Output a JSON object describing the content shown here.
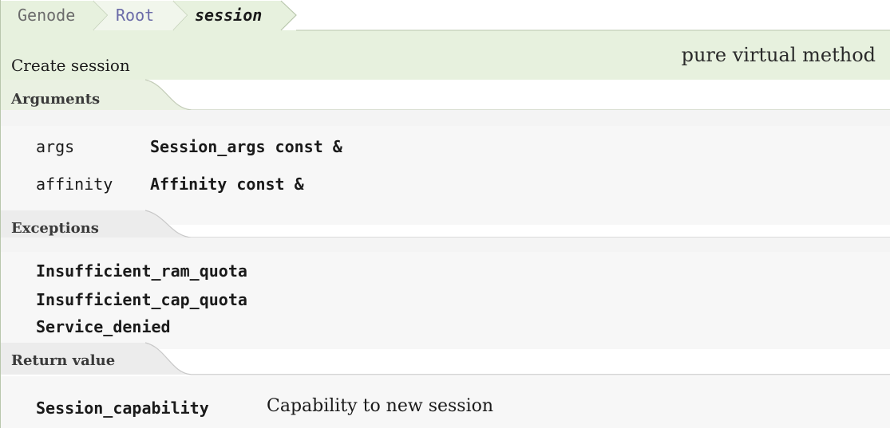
{
  "breadcrumb": {
    "items": [
      "Genode",
      "Root",
      "session"
    ]
  },
  "header": {
    "subtitle": "Create session",
    "method_kind": "pure virtual method"
  },
  "sections": {
    "arguments": {
      "title": "Arguments",
      "rows": [
        {
          "name": "args",
          "type": "Session_args const &"
        },
        {
          "name": "affinity",
          "type": "Affinity const &"
        }
      ]
    },
    "exceptions": {
      "title": "Exceptions",
      "items": [
        "Insufficient_ram_quota",
        "Insufficient_cap_quota",
        "Service_denied"
      ]
    },
    "return_value": {
      "title": "Return value",
      "type": "Session_capability",
      "description": "Capability to new session"
    }
  },
  "colors": {
    "header_bg": "#e7f1de",
    "breadcrumb_fill": "#e7f1de",
    "breadcrumb_stroke": "#b9c7ad",
    "tab_fill": "#ececec",
    "section_bg": "#f7f7f7",
    "root_link": "#6a6aa8"
  }
}
